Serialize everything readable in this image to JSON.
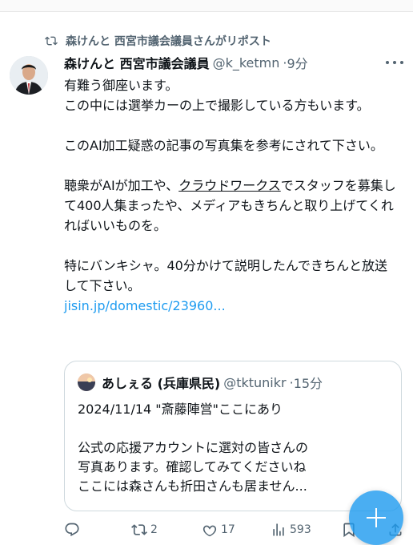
{
  "repost_banner": {
    "text": "森けんと 西宮市議会議員さんがリポスト",
    "icon": "repost-icon"
  },
  "tweet": {
    "author_name": "森けんと 西宮市議会議員",
    "handle": "@k_ketmn",
    "time": "9分",
    "para1": "有難う御座います。\nこの中には選挙カーの上で撮影している方もいます。",
    "para2": "このAI加工疑惑の記事の写真集を参考にされて下さい。",
    "para3_pre": "聴衆がAIが加工や、",
    "para3_underlined": "クラウドワークス",
    "para3_post": "でスタッフを募集して400人集まったや、メディアもきちんと取り上げてくれればいいものを。",
    "para4": "特にバンキシャ。40分かけて説明したんできちんと放送して下さい。",
    "link": "jisin.jp/domestic/23960..."
  },
  "quote": {
    "author_name": "あしぇる (兵庫県民)",
    "handle": "@tktunikr",
    "time": "15分",
    "text": "2024/11/14 \"斎藤陣営\"ここにあり\n\n公式の応援アカウントに選対の皆さんの\n写真あります。確認してみてくださいね\nここには森さんも折田さんも居ません..."
  },
  "actions": {
    "reply_count": "",
    "repost_count": "2",
    "like_count": "17",
    "views_count": "593"
  },
  "colors": {
    "accent": "#1d9bf0",
    "muted": "#536471",
    "text": "#0f1419",
    "border": "#cfd9de"
  }
}
